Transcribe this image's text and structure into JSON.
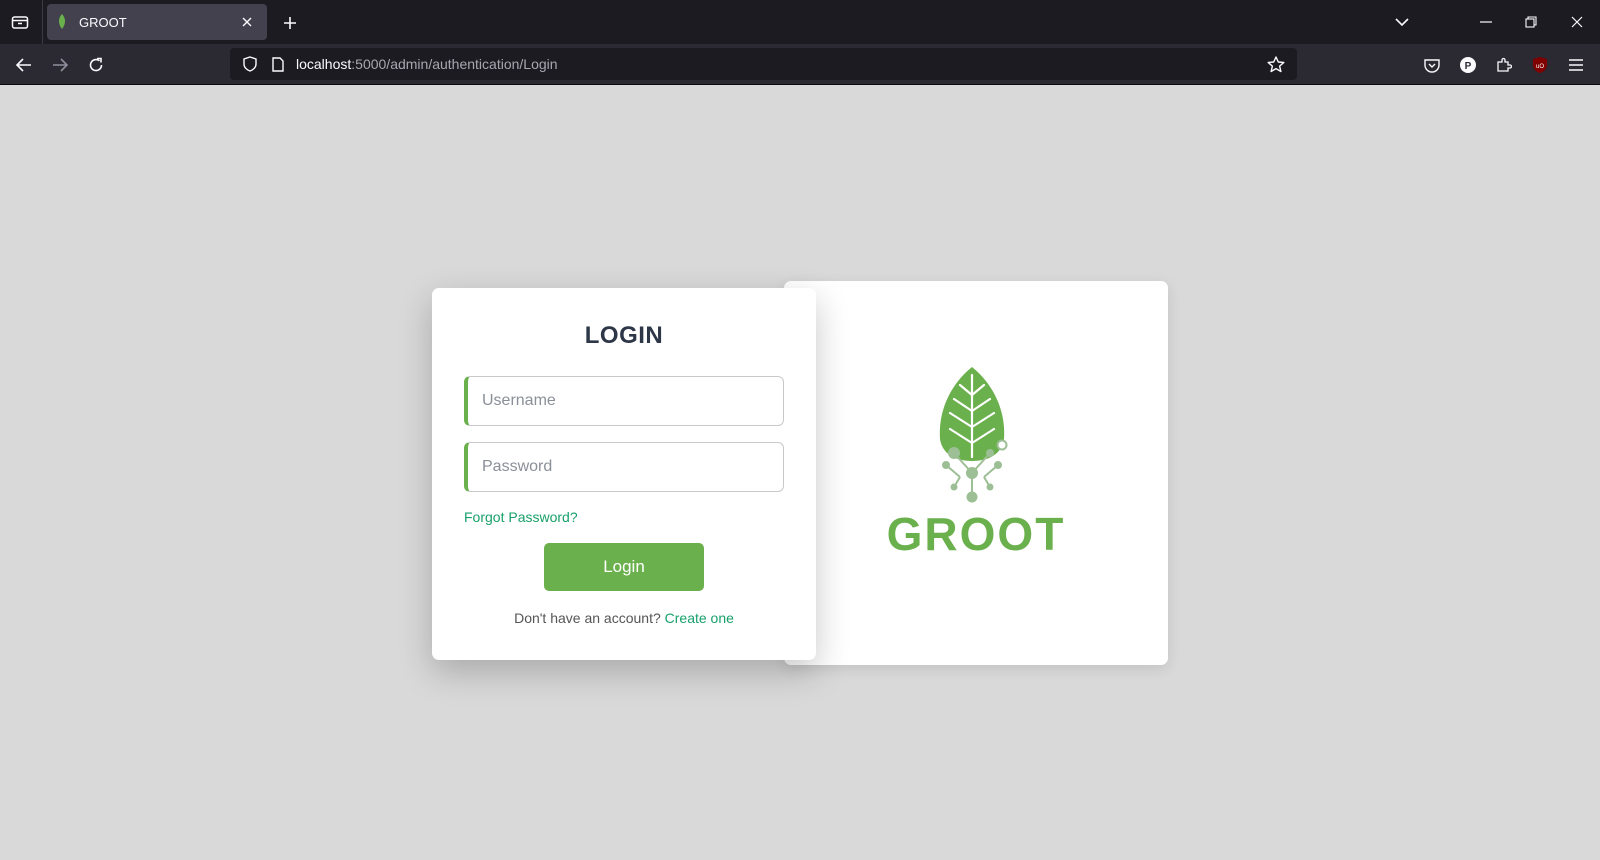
{
  "browser": {
    "tab_title": "GROOT",
    "url_host": "localhost",
    "url_path": ":5000/admin/authentication/Login"
  },
  "login": {
    "title": "LOGIN",
    "username_placeholder": "Username",
    "password_placeholder": "Password",
    "forgot_label": "Forgot Password?",
    "button_label": "Login",
    "signup_prompt": "Don't have an account?",
    "signup_link": "Create one"
  },
  "brand": {
    "logo_text": "GROOT",
    "accent_color": "#6ab04c",
    "link_color": "#18a06a"
  }
}
